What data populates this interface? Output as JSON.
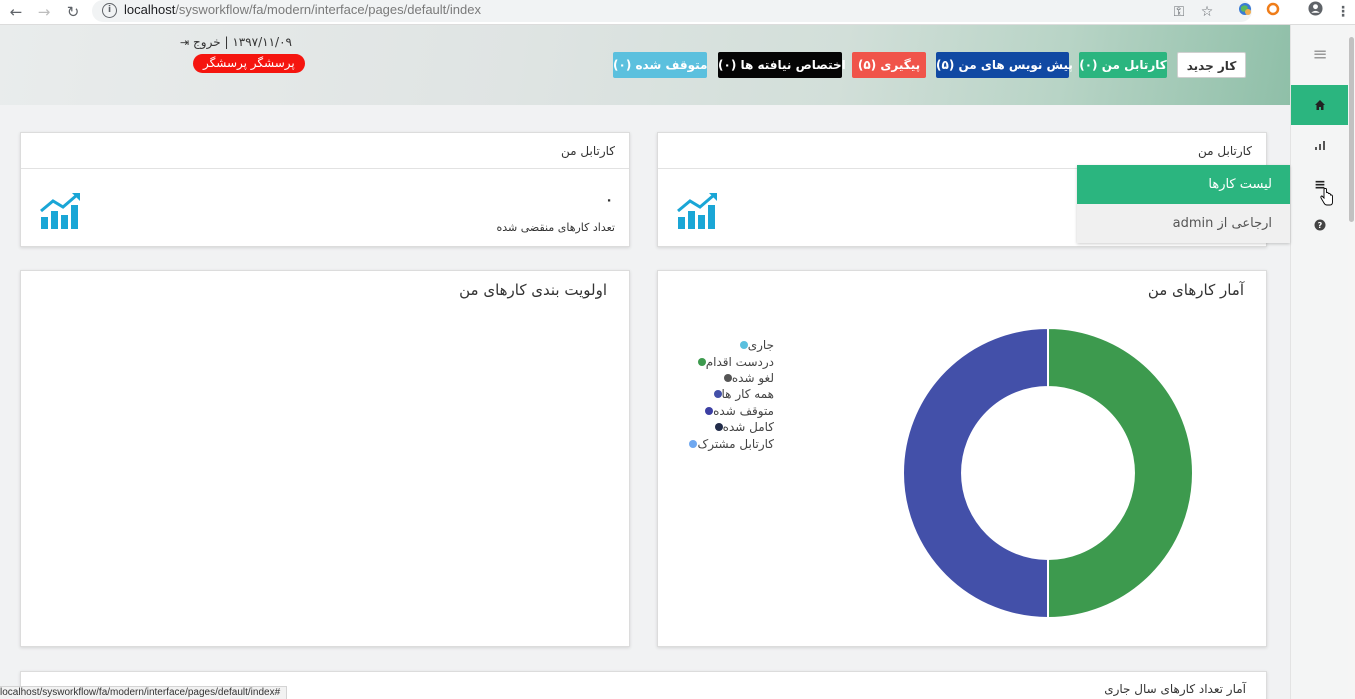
{
  "browser": {
    "url_host": "localhost",
    "url_path": "/sysworkflow/fa/modern/interface/pages/default/index"
  },
  "header": {
    "new_task": "کار جدید",
    "inbox": "کارتابل من (۰)",
    "drafts": "پیش نویس های من (۵)",
    "followup": "پیگیری (۵)",
    "unassigned": "اختصاص نیافته ها (۰)",
    "paused": "متوقف شده (۰)",
    "date_logout": "۱۳۹۷/۱۱/۰۹ | خروج",
    "user_badge": "پرسشگر پرسشگر"
  },
  "menu": {
    "task_list": "لیست کارها",
    "referred_from": "ارجاعی از admin"
  },
  "cards": {
    "card1_title": "کارتابل من",
    "card2_title": "کارتابل من",
    "card2_value": "۰",
    "card2_label": "تعداد کارهای منقضی شده",
    "stats_title": "آمار کارهای من",
    "priority_title": "اولویت بندی کارهای من",
    "yearly_title": "آمار تعداد کارهای سال جاری"
  },
  "legend": [
    {
      "label": "جاری",
      "color": "#5bc0de"
    },
    {
      "label": "دردست اقدام",
      "color": "#3d9a4e"
    },
    {
      "label": "لغو شده",
      "color": "#555555"
    },
    {
      "label": "همه کار ها",
      "color": "#4350a9"
    },
    {
      "label": "متوقف شده",
      "color": "#3c3fa3"
    },
    {
      "label": "کامل شده",
      "color": "#222c4a"
    },
    {
      "label": "کارتابل مشترک",
      "color": "#6fa8f0"
    }
  ],
  "donut": {
    "segments": [
      {
        "name": "دردست اقدام",
        "value": 50,
        "color": "#3d9a4e"
      },
      {
        "name": "همه کار ها",
        "value": 50,
        "color": "#4350a9"
      }
    ]
  },
  "status_bar": "localhost/sysworkflow/fa/modern/interface/pages/default/index#"
}
